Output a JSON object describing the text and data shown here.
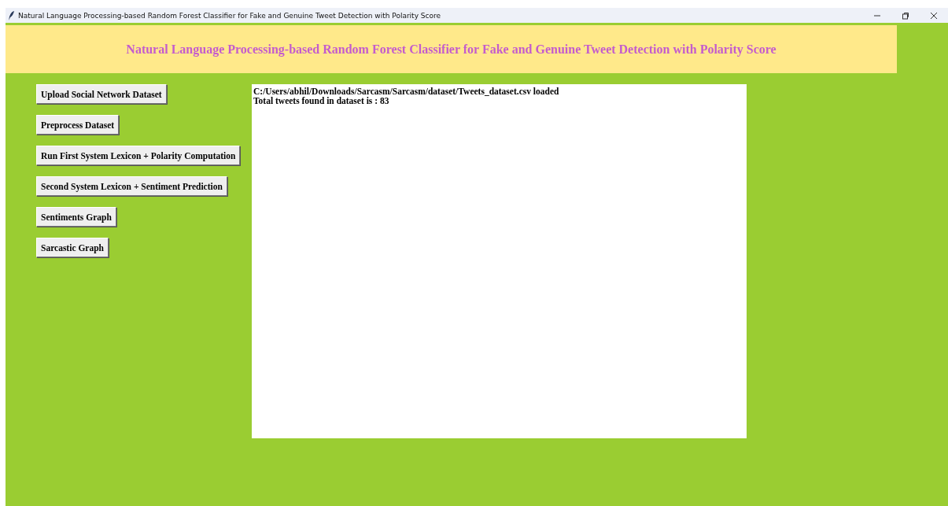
{
  "window": {
    "title": "Natural Language Processing-based Random Forest Classifier for Fake and Genuine Tweet Detection with Polarity Score"
  },
  "header": {
    "title": "Natural Language Processing-based Random Forest Classifier for Fake and Genuine Tweet Detection with Polarity Score"
  },
  "buttons": [
    "Upload Social Network Dataset",
    "Preprocess Dataset",
    "Run First System Lexicon + Polarity Computation",
    "Second System Lexicon + Sentiment Prediction",
    "Sentiments Graph",
    "Sarcastic Graph"
  ],
  "output": {
    "lines": [
      "C:/Users/abhil/Downloads/Sarcasm/Sarcasm/dataset/Tweets_dataset.csv loaded",
      "Total tweets found in dataset is : 83"
    ]
  }
}
